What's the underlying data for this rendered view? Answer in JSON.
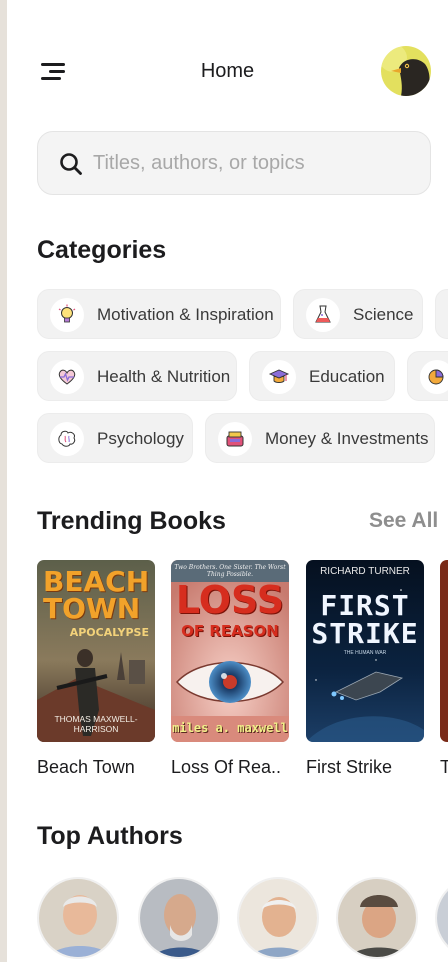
{
  "header": {
    "title": "Home",
    "menu_icon": "menu-icon",
    "avatar": "bird-avatar"
  },
  "search": {
    "placeholder": "Titles, authors, or topics"
  },
  "categories": {
    "title": "Categories",
    "rows": [
      [
        {
          "label": "Motivation & Inspiration",
          "icon": "lightbulb-icon"
        },
        {
          "label": "Science",
          "icon": "flask-icon"
        }
      ],
      [
        {
          "label": "Health & Nutrition",
          "icon": "heart-icon"
        },
        {
          "label": "Education",
          "icon": "graduation-cap-icon"
        }
      ],
      [
        {
          "label": "Psychology",
          "icon": "brain-icon"
        },
        {
          "label": "Money & Investments",
          "icon": "money-bag-icon"
        }
      ]
    ]
  },
  "trending": {
    "title": "Trending Books",
    "see_all": "See All",
    "books": [
      {
        "title": "Beach Town",
        "cover_title": "BEACH TOWN",
        "cover_subtitle": "APOCALYPSE",
        "cover_author": "THOMAS MAXWELL-HARRISON"
      },
      {
        "title": "Loss Of Rea..",
        "cover_tagline": "Two Brothers. One Sister. The Worst Thing Possible.",
        "cover_title": "LOSS",
        "cover_subtitle": "OF REASON",
        "cover_author": "miles a. maxwell"
      },
      {
        "title": "First Strike",
        "cover_author": "RICHARD TURNER",
        "cover_title": "FIRST",
        "cover_subtitle": "STRIKE",
        "cover_series": "THE HUMAN WAR"
      }
    ]
  },
  "authors": {
    "title": "Top Authors"
  },
  "colors": {
    "text": "#1c1c1e",
    "muted": "#8e8e8e",
    "chip_bg": "#f2f2f2",
    "search_bg": "#f4f4f4"
  }
}
